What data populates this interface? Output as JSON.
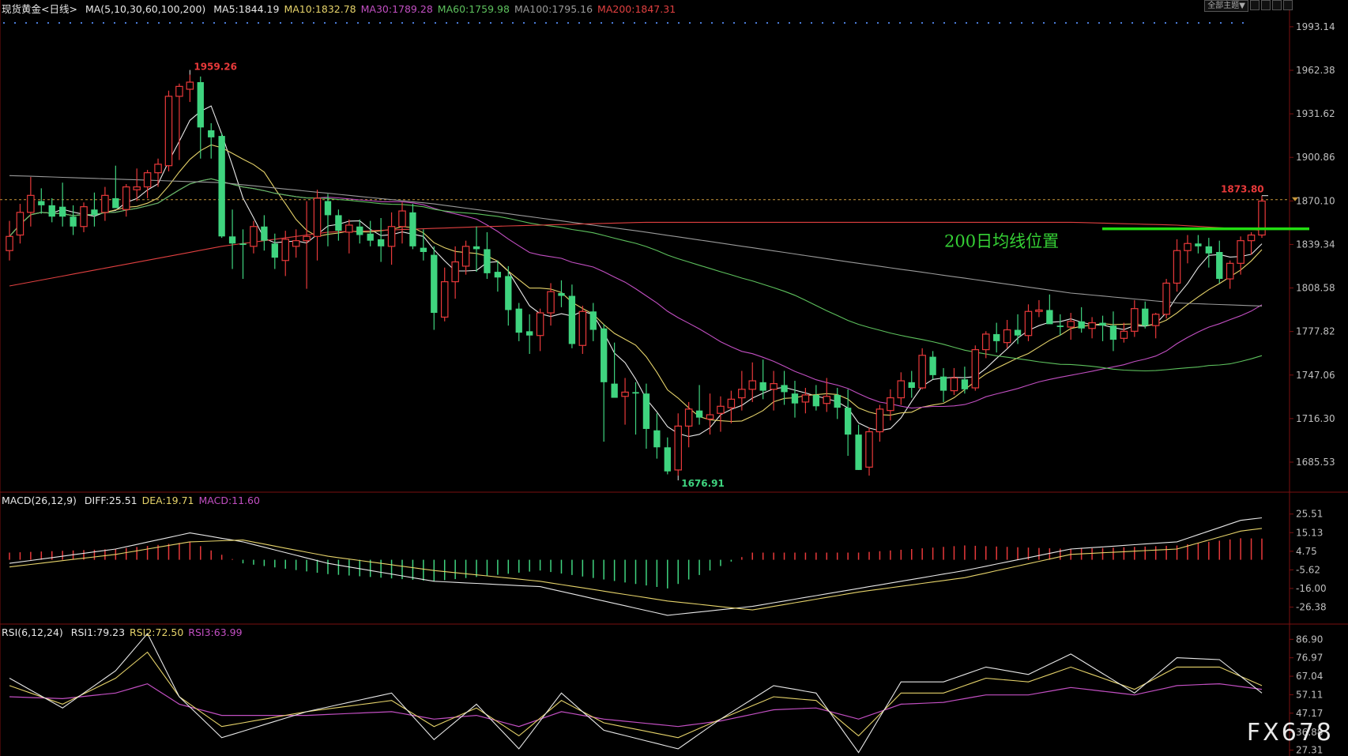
{
  "header": {
    "instrument": "现货黄金<日线>",
    "ma_label": "MA(5,10,30,60,100,200)",
    "ma_items": [
      {
        "text": "MA5:1844.19",
        "color": "#e8e8e8"
      },
      {
        "text": "MA10:1832.78",
        "color": "#e6d36a"
      },
      {
        "text": "MA30:1789.28",
        "color": "#c24fc2"
      },
      {
        "text": "MA60:1759.98",
        "color": "#5dc15d"
      },
      {
        "text": "MA100:1795.16",
        "color": "#9a9a9a"
      },
      {
        "text": "MA200:1847.31",
        "color": "#e04040"
      }
    ],
    "theme_button": "全部主题▼"
  },
  "annotation_text": "200日均线位置",
  "watermark": "FX678",
  "colors": {
    "up": "#e8393a",
    "down": "#3fd47f",
    "axis_text": "#bfbfbf",
    "accent_green": "#22dd11"
  },
  "chart_data": [
    {
      "type": "candlestick",
      "title": "现货黄金<日线>",
      "y_ticks": [
        "1993.14",
        "1962.38",
        "1931.62",
        "1900.86",
        "1870.10",
        "1839.34",
        "1808.58",
        "1777.82",
        "1747.06",
        "1716.30",
        "1685.53"
      ],
      "ylim": [
        1666.0,
        2002.0
      ],
      "last_price": "1873.80",
      "ohlc": [
        [
          1835,
          1856,
          1828,
          1845
        ],
        [
          1846,
          1868,
          1840,
          1862
        ],
        [
          1862,
          1887,
          1852,
          1874
        ],
        [
          1870,
          1879,
          1861,
          1867
        ],
        [
          1867,
          1872,
          1855,
          1859
        ],
        [
          1866,
          1883,
          1852,
          1859
        ],
        [
          1859,
          1867,
          1846,
          1852
        ],
        [
          1852,
          1869,
          1848,
          1866
        ],
        [
          1864,
          1876,
          1852,
          1860
        ],
        [
          1862,
          1880,
          1856,
          1874
        ],
        [
          1872,
          1895,
          1866,
          1865
        ],
        [
          1864,
          1882,
          1859,
          1880
        ],
        [
          1878,
          1893,
          1870,
          1880
        ],
        [
          1880,
          1892,
          1872,
          1890
        ],
        [
          1890,
          1900,
          1880,
          1896
        ],
        [
          1895,
          1948,
          1891,
          1944
        ],
        [
          1944,
          1953,
          1899,
          1951
        ],
        [
          1949,
          1959.26,
          1940,
          1954
        ],
        [
          1954,
          1958,
          1900,
          1922
        ],
        [
          1920,
          1925,
          1900,
          1915
        ],
        [
          1916,
          1918,
          1844,
          1845
        ],
        [
          1845,
          1864,
          1822,
          1840
        ],
        [
          1840,
          1850,
          1815,
          1839
        ],
        [
          1838,
          1856,
          1833,
          1852
        ],
        [
          1852,
          1860,
          1835,
          1842
        ],
        [
          1840,
          1847,
          1822,
          1830
        ],
        [
          1828,
          1849,
          1817,
          1843
        ],
        [
          1838,
          1850,
          1830,
          1842
        ],
        [
          1842,
          1870,
          1808,
          1845
        ],
        [
          1845,
          1878,
          1828,
          1872
        ],
        [
          1870,
          1875,
          1838,
          1860
        ],
        [
          1860,
          1864,
          1842,
          1849
        ],
        [
          1848,
          1857,
          1833,
          1853
        ],
        [
          1852,
          1857,
          1840,
          1846
        ],
        [
          1847,
          1856,
          1838,
          1842
        ],
        [
          1843,
          1858,
          1827,
          1838
        ],
        [
          1838,
          1862,
          1825,
          1852
        ],
        [
          1852,
          1869,
          1840,
          1863
        ],
        [
          1862,
          1868,
          1836,
          1838
        ],
        [
          1837,
          1850,
          1828,
          1834
        ],
        [
          1832,
          1838,
          1779,
          1791
        ],
        [
          1788,
          1823,
          1785,
          1813
        ],
        [
          1813,
          1838,
          1801,
          1827
        ],
        [
          1824,
          1842,
          1818,
          1838
        ],
        [
          1838,
          1852,
          1820,
          1836
        ],
        [
          1836,
          1848,
          1815,
          1819
        ],
        [
          1820,
          1828,
          1806,
          1816
        ],
        [
          1817,
          1824,
          1782,
          1793
        ],
        [
          1794,
          1798,
          1771,
          1777
        ],
        [
          1778,
          1790,
          1762,
          1775
        ],
        [
          1775,
          1794,
          1764,
          1791
        ],
        [
          1791,
          1812,
          1782,
          1806
        ],
        [
          1805,
          1814,
          1795,
          1803
        ],
        [
          1803,
          1811,
          1766,
          1769
        ],
        [
          1768,
          1796,
          1762,
          1792
        ],
        [
          1792,
          1798,
          1771,
          1779
        ],
        [
          1780,
          1783,
          1700,
          1742
        ],
        [
          1741,
          1770,
          1735,
          1731
        ],
        [
          1732,
          1745,
          1712,
          1735
        ],
        [
          1735,
          1742,
          1705,
          1734
        ],
        [
          1734,
          1741,
          1695,
          1709
        ],
        [
          1708,
          1720,
          1688,
          1696
        ],
        [
          1696,
          1703,
          1676.91,
          1679
        ],
        [
          1680,
          1720,
          1676,
          1711
        ],
        [
          1711,
          1728,
          1696,
          1723
        ],
        [
          1722,
          1740,
          1712,
          1717
        ],
        [
          1716,
          1734,
          1705,
          1719
        ],
        [
          1720,
          1732,
          1707,
          1725
        ],
        [
          1724,
          1736,
          1713,
          1730
        ],
        [
          1731,
          1750,
          1722,
          1737
        ],
        [
          1737,
          1756,
          1728,
          1743
        ],
        [
          1742,
          1758,
          1730,
          1736
        ],
        [
          1737,
          1750,
          1722,
          1741
        ],
        [
          1740,
          1750,
          1726,
          1735
        ],
        [
          1734,
          1743,
          1717,
          1727
        ],
        [
          1728,
          1738,
          1720,
          1733
        ],
        [
          1733,
          1740,
          1722,
          1725
        ],
        [
          1727,
          1745,
          1721,
          1732
        ],
        [
          1733,
          1738,
          1716,
          1724
        ],
        [
          1724,
          1737,
          1690,
          1705
        ],
        [
          1705,
          1712,
          1680,
          1680
        ],
        [
          1682,
          1710,
          1676,
          1707
        ],
        [
          1707,
          1726,
          1700,
          1723
        ],
        [
          1722,
          1737,
          1715,
          1731
        ],
        [
          1731,
          1749,
          1726,
          1743
        ],
        [
          1742,
          1750,
          1731,
          1738
        ],
        [
          1738,
          1766,
          1737,
          1761
        ],
        [
          1760,
          1764,
          1744,
          1747
        ],
        [
          1746,
          1752,
          1728,
          1736
        ],
        [
          1736,
          1752,
          1733,
          1745
        ],
        [
          1744,
          1753,
          1734,
          1737
        ],
        [
          1738,
          1768,
          1736,
          1765
        ],
        [
          1765,
          1778,
          1759,
          1776
        ],
        [
          1776,
          1784,
          1763,
          1771
        ],
        [
          1770,
          1786,
          1766,
          1779
        ],
        [
          1779,
          1790,
          1769,
          1775
        ],
        [
          1775,
          1797,
          1771,
          1792
        ],
        [
          1792,
          1800,
          1788,
          1793
        ],
        [
          1793,
          1804,
          1785,
          1783
        ],
        [
          1782,
          1790,
          1775,
          1781
        ],
        [
          1781,
          1791,
          1772,
          1785
        ],
        [
          1785,
          1795,
          1777,
          1780
        ],
        [
          1780,
          1788,
          1773,
          1784
        ],
        [
          1784,
          1789,
          1771,
          1782
        ],
        [
          1782,
          1792,
          1764,
          1772
        ],
        [
          1773,
          1784,
          1770,
          1778
        ],
        [
          1778,
          1800,
          1774,
          1794
        ],
        [
          1794,
          1799,
          1780,
          1782
        ],
        [
          1782,
          1791,
          1773,
          1790
        ],
        [
          1790,
          1815,
          1787,
          1812
        ],
        [
          1812,
          1843,
          1806,
          1835
        ],
        [
          1835,
          1846,
          1826,
          1840
        ],
        [
          1840,
          1846,
          1833,
          1838
        ],
        [
          1838,
          1844,
          1823,
          1833
        ],
        [
          1834,
          1842,
          1812,
          1815
        ],
        [
          1815,
          1828,
          1808,
          1826
        ],
        [
          1826,
          1845,
          1818,
          1842
        ],
        [
          1842,
          1848,
          1832,
          1846
        ],
        [
          1846,
          1873.8,
          1844,
          1870
        ]
      ],
      "high_label": "1959.26",
      "low_label": "1676.91",
      "ma_series": [
        {
          "name": "MA5",
          "color": "#e8e8e8",
          "period": 5
        },
        {
          "name": "MA10",
          "color": "#e6d36a",
          "period": 10
        },
        {
          "name": "MA30",
          "color": "#c24fc2",
          "period": 30
        },
        {
          "name": "MA60",
          "color": "#5dc15d",
          "period": 60
        },
        {
          "name": "MA100",
          "color": "#9a9a9a",
          "anchors": [
            [
              0,
              1888
            ],
            [
              20,
              1883
            ],
            [
              40,
              1868
            ],
            [
              60,
              1848
            ],
            [
              80,
              1826
            ],
            [
              100,
              1805
            ],
            [
              110,
              1798
            ],
            [
              121,
              1795
            ]
          ]
        },
        {
          "name": "MA200",
          "color": "#e04040",
          "anchors": [
            [
              0,
              1810
            ],
            [
              20,
              1838
            ],
            [
              30,
              1848
            ],
            [
              45,
              1852
            ],
            [
              60,
              1855
            ],
            [
              80,
              1855
            ],
            [
              100,
              1855
            ],
            [
              110,
              1853
            ],
            [
              121,
              1848
            ]
          ]
        }
      ],
      "annotation": {
        "text": "200日均线位置",
        "price": 1850.4
      }
    },
    {
      "type": "macd",
      "label": "MACD(26,12,9)",
      "legend": [
        {
          "text": "DIFF:25.51",
          "color": "#e8e8e8"
        },
        {
          "text": "DEA:19.71",
          "color": "#e6d36a"
        },
        {
          "text": "MACD:11.60",
          "color": "#c24fc2"
        }
      ],
      "y_ticks": [
        "25.51",
        "15.13",
        "4.75",
        "-5.62",
        "-16.00",
        "-26.38"
      ],
      "ylim": [
        -35,
        32
      ],
      "diff_anchors": [
        [
          0,
          -2
        ],
        [
          10,
          6
        ],
        [
          17,
          15
        ],
        [
          22,
          10
        ],
        [
          30,
          -2
        ],
        [
          40,
          -12
        ],
        [
          50,
          -15
        ],
        [
          62,
          -31
        ],
        [
          70,
          -26
        ],
        [
          80,
          -16
        ],
        [
          90,
          -6
        ],
        [
          100,
          6
        ],
        [
          110,
          10
        ],
        [
          116,
          22
        ],
        [
          121,
          25.51
        ]
      ],
      "dea_anchors": [
        [
          0,
          -4
        ],
        [
          10,
          3
        ],
        [
          17,
          10
        ],
        [
          22,
          11
        ],
        [
          30,
          2
        ],
        [
          40,
          -6
        ],
        [
          50,
          -12
        ],
        [
          62,
          -23
        ],
        [
          70,
          -28
        ],
        [
          80,
          -18
        ],
        [
          90,
          -10
        ],
        [
          100,
          3
        ],
        [
          110,
          6
        ],
        [
          116,
          16
        ],
        [
          121,
          19.71
        ]
      ]
    },
    {
      "type": "rsi",
      "label": "RSI(6,12,24)",
      "legend": [
        {
          "text": "RSI1:79.23",
          "color": "#e8e8e8"
        },
        {
          "text": "RSI2:72.50",
          "color": "#e6d36a"
        },
        {
          "text": "RSI3:63.99",
          "color": "#c24fc2"
        }
      ],
      "y_ticks": [
        "86.90",
        "76.97",
        "67.04",
        "57.11",
        "47.17",
        "36.88",
        "27.31"
      ],
      "ylim": [
        25,
        90
      ],
      "rsi1_anchors": [
        [
          0,
          66
        ],
        [
          5,
          50
        ],
        [
          10,
          70
        ],
        [
          13,
          90
        ],
        [
          16,
          56
        ],
        [
          20,
          34
        ],
        [
          28,
          48
        ],
        [
          36,
          58
        ],
        [
          40,
          33
        ],
        [
          44,
          52
        ],
        [
          48,
          28
        ],
        [
          52,
          58
        ],
        [
          56,
          38
        ],
        [
          63,
          28
        ],
        [
          67,
          44
        ],
        [
          72,
          62
        ],
        [
          76,
          58
        ],
        [
          80,
          26
        ],
        [
          84,
          64
        ],
        [
          88,
          64
        ],
        [
          92,
          72
        ],
        [
          96,
          68
        ],
        [
          100,
          79
        ],
        [
          106,
          58
        ],
        [
          110,
          77
        ],
        [
          114,
          76
        ],
        [
          118,
          58
        ],
        [
          121,
          79.23
        ]
      ],
      "rsi2_anchors": [
        [
          0,
          62
        ],
        [
          5,
          52
        ],
        [
          10,
          66
        ],
        [
          13,
          80
        ],
        [
          16,
          56
        ],
        [
          20,
          40
        ],
        [
          28,
          48
        ],
        [
          36,
          54
        ],
        [
          40,
          40
        ],
        [
          44,
          50
        ],
        [
          48,
          35
        ],
        [
          52,
          54
        ],
        [
          56,
          42
        ],
        [
          63,
          34
        ],
        [
          67,
          44
        ],
        [
          72,
          56
        ],
        [
          76,
          54
        ],
        [
          80,
          35
        ],
        [
          84,
          58
        ],
        [
          88,
          58
        ],
        [
          92,
          66
        ],
        [
          96,
          64
        ],
        [
          100,
          72
        ],
        [
          106,
          60
        ],
        [
          110,
          72
        ],
        [
          114,
          72
        ],
        [
          118,
          62
        ],
        [
          121,
          72.5
        ]
      ],
      "rsi3_anchors": [
        [
          0,
          56
        ],
        [
          5,
          55
        ],
        [
          10,
          58
        ],
        [
          13,
          63
        ],
        [
          16,
          52
        ],
        [
          20,
          46
        ],
        [
          28,
          46
        ],
        [
          36,
          48
        ],
        [
          40,
          44
        ],
        [
          44,
          46
        ],
        [
          48,
          40
        ],
        [
          52,
          48
        ],
        [
          56,
          44
        ],
        [
          63,
          40
        ],
        [
          67,
          43
        ],
        [
          72,
          49
        ],
        [
          76,
          50
        ],
        [
          80,
          44
        ],
        [
          84,
          52
        ],
        [
          88,
          53
        ],
        [
          92,
          57
        ],
        [
          96,
          57
        ],
        [
          100,
          61
        ],
        [
          106,
          57
        ],
        [
          110,
          62
        ],
        [
          114,
          63
        ],
        [
          118,
          60
        ],
        [
          121,
          63.99
        ]
      ]
    }
  ]
}
